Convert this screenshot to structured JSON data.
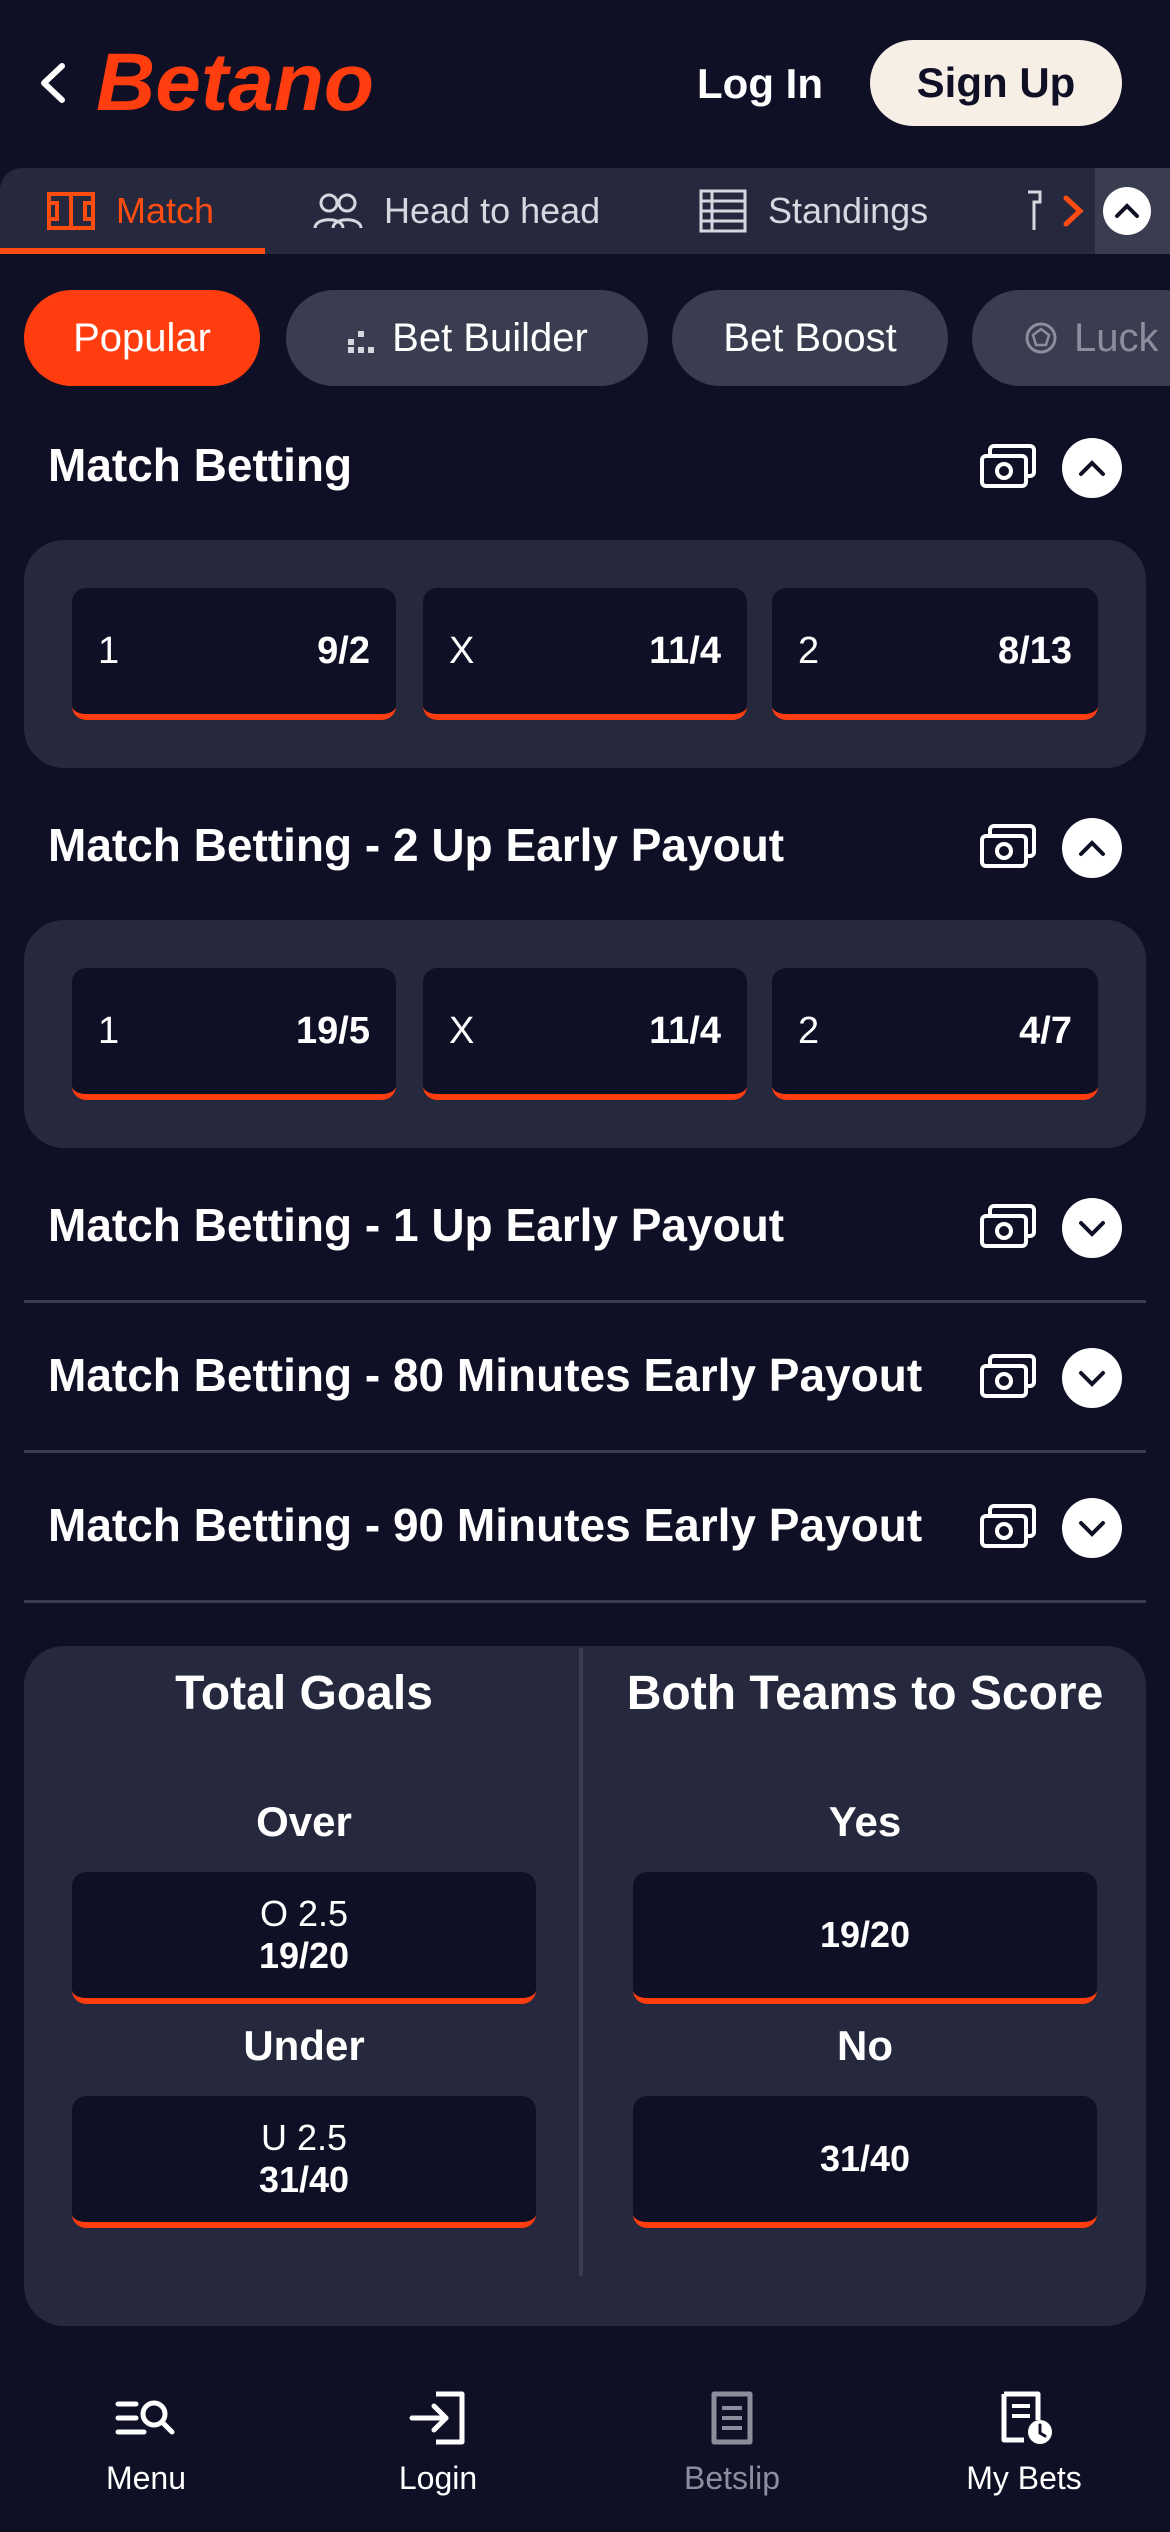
{
  "header": {
    "logo_text": "Betano",
    "login_label": "Log In",
    "signup_label": "Sign Up"
  },
  "tabs": [
    {
      "label": "Match",
      "icon": "pitch-icon",
      "active": true
    },
    {
      "label": "Head to head",
      "icon": "users-icon",
      "active": false
    },
    {
      "label": "Standings",
      "icon": "table-icon",
      "active": false
    }
  ],
  "chips": [
    {
      "label": "Popular",
      "active": true
    },
    {
      "label": "Bet Builder",
      "icon": "bars-icon"
    },
    {
      "label": "Bet Boost"
    },
    {
      "label": "Luck",
      "icon": "ball-icon"
    }
  ],
  "markets": [
    {
      "title": "Match Betting",
      "expanded": true,
      "odds": [
        {
          "label": "1",
          "price": "9/2"
        },
        {
          "label": "X",
          "price": "11/4"
        },
        {
          "label": "2",
          "price": "8/13"
        }
      ]
    },
    {
      "title": "Match Betting - 2 Up Early Payout",
      "expanded": true,
      "odds": [
        {
          "label": "1",
          "price": "19/5"
        },
        {
          "label": "X",
          "price": "11/4"
        },
        {
          "label": "2",
          "price": "4/7"
        }
      ]
    },
    {
      "title": "Match Betting - 1 Up Early Payout",
      "expanded": false
    },
    {
      "title": "Match Betting - 80 Minutes Early Payout",
      "expanded": false
    },
    {
      "title": "Match Betting - 90 Minutes Early Payout",
      "expanded": false
    }
  ],
  "goals_card": {
    "total_goals": {
      "title": "Total Goals",
      "over_label": "Over",
      "over_line": "O 2.5",
      "over_price": "19/20",
      "under_label": "Under",
      "under_line": "U 2.5",
      "under_price": "31/40"
    },
    "btts": {
      "title": "Both Teams to Score",
      "yes_label": "Yes",
      "yes_price": "19/20",
      "no_label": "No",
      "no_price": "31/40"
    }
  },
  "bottom_nav": [
    {
      "label": "Menu",
      "icon": "menu-search-icon"
    },
    {
      "label": "Login",
      "icon": "login-icon"
    },
    {
      "label": "Betslip",
      "icon": "betslip-icon",
      "disabled": true
    },
    {
      "label": "My Bets",
      "icon": "my-bets-icon"
    }
  ],
  "colors": {
    "background": "#0f1025",
    "card": "#26283d",
    "accent": "#ff3d0f",
    "chip": "#3a3c50"
  }
}
